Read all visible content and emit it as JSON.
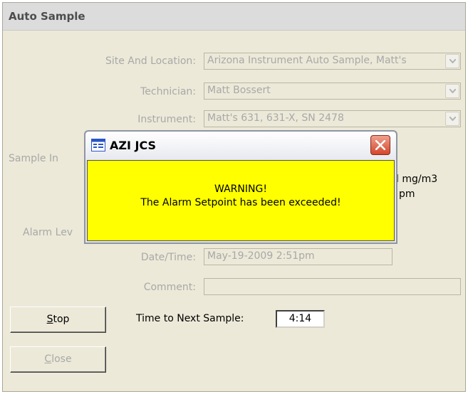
{
  "window": {
    "title": "Auto Sample"
  },
  "form": {
    "site": {
      "label": "Site And Location:",
      "value": "Arizona Instrument Auto Sample, Matt's"
    },
    "technician": {
      "label": "Technician:",
      "value": "Matt Bossert"
    },
    "instrument": {
      "label": "Instrument:",
      "value": "Matt's 631, 631-X, SN 2478"
    },
    "sample_label_fragment": "Sample In",
    "reading_unit_1": "l mg/m3",
    "reading_unit_2": "pm",
    "alarm_label_fragment": "Alarm Lev",
    "datetime": {
      "label": "Date/Time:",
      "value": "May-19-2009 2:51pm"
    },
    "comment": {
      "label": "Comment:",
      "value": ""
    }
  },
  "buttons": {
    "stop": {
      "mnemonic": "S",
      "rest": "top"
    },
    "close": {
      "mnemonic": "C",
      "rest": "lose"
    }
  },
  "timer": {
    "label": "Time to Next Sample:",
    "value": "4:14"
  },
  "dialog": {
    "title": "AZI JCS",
    "message_line1": "WARNING!",
    "message_line2": "The Alarm Setpoint has been exceeded!",
    "body_color": "#ffff00"
  },
  "icons": {
    "combo_arrow": "chevron-down-icon",
    "dialog_app": "window-app-icon",
    "dialog_close": "close-icon"
  }
}
